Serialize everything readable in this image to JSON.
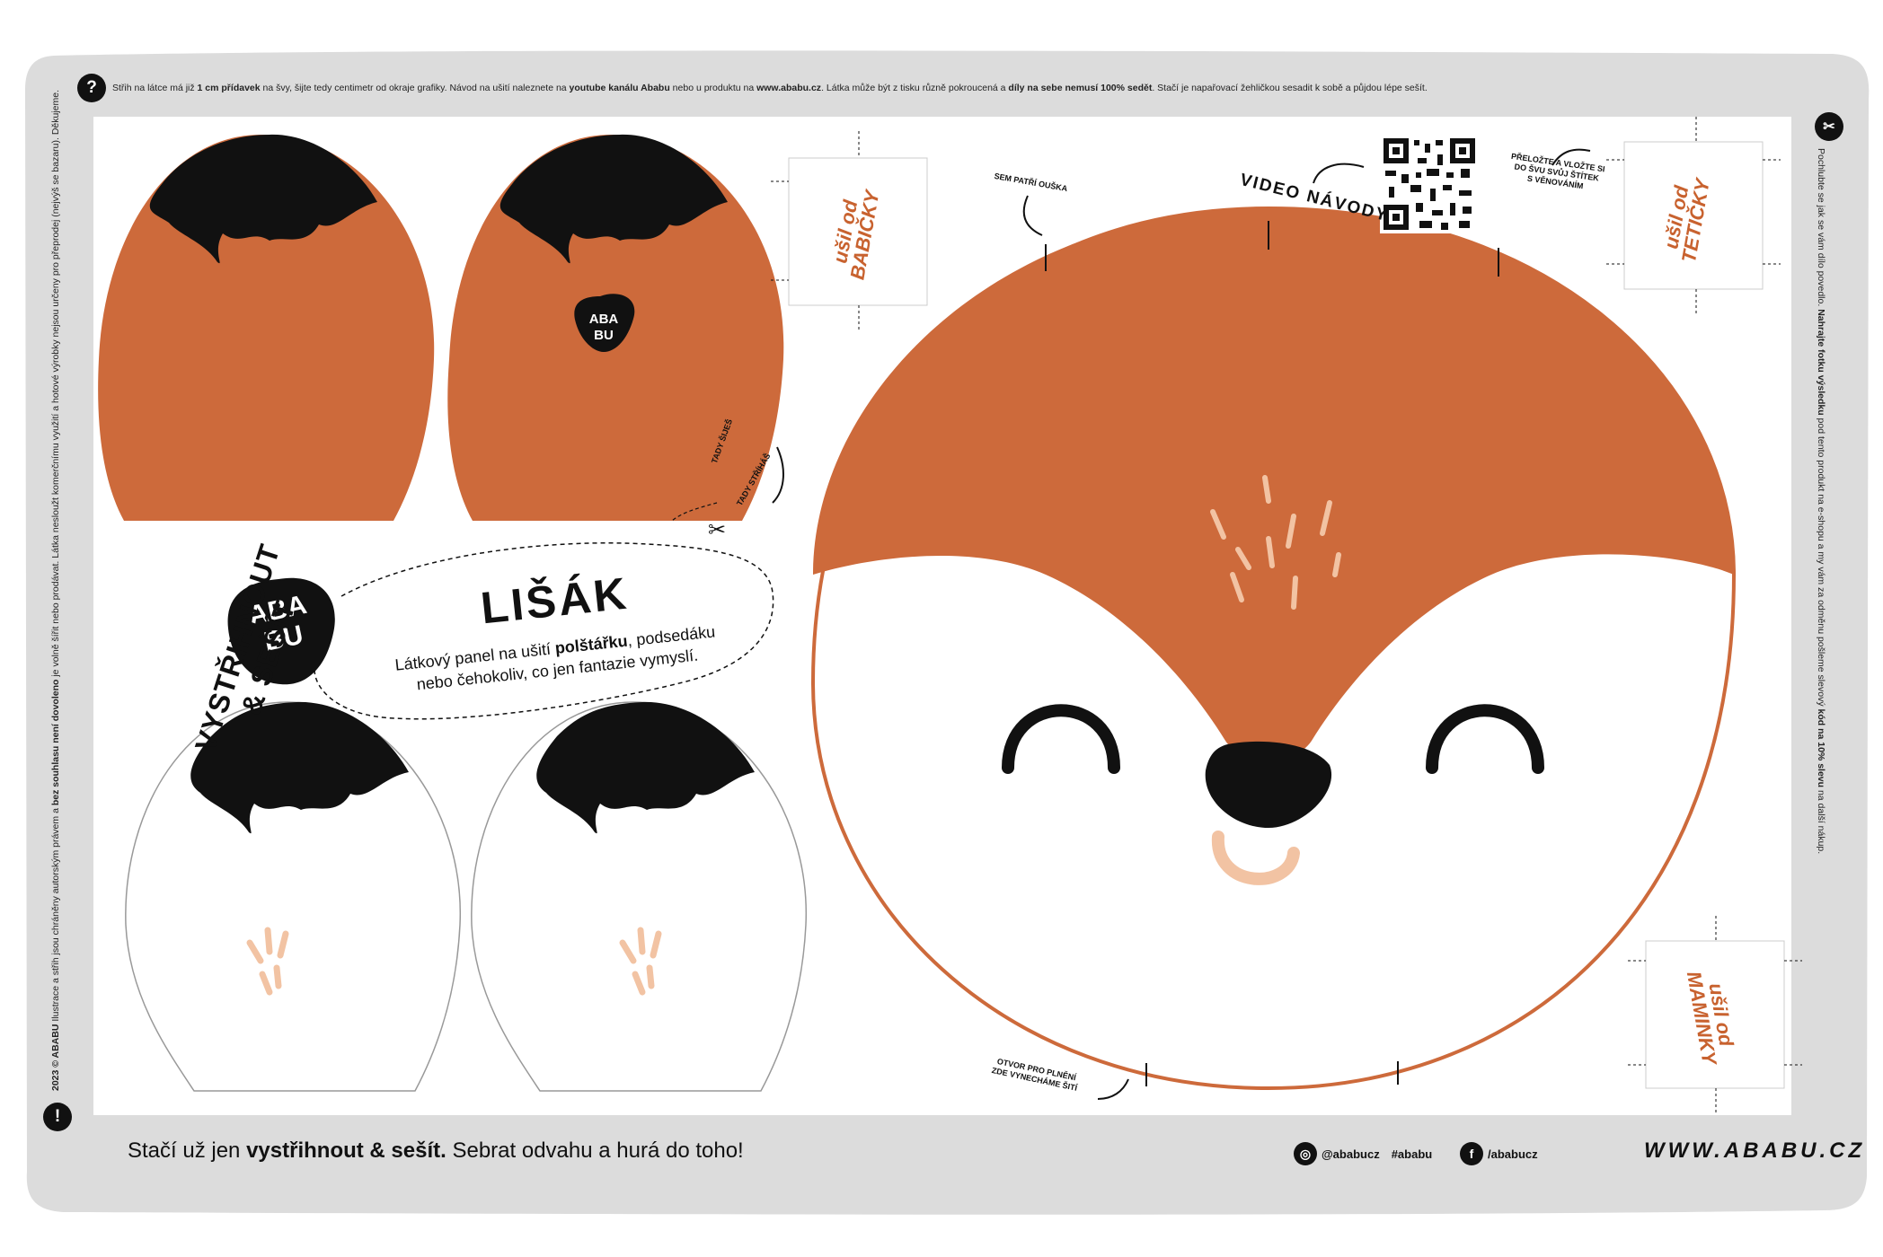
{
  "colors": {
    "fox_orange": "#cd6a3b",
    "black": "#111111",
    "frame_gray": "#dcdcdc",
    "cheek": "#f2c3a3"
  },
  "top_note": {
    "icon": "?",
    "t1": "Střih na látce má již ",
    "b1": "1 cm přídavek",
    "t2": " na švy, šijte tedy centimetr od okraje grafiky. Návod na ušití naleznete na ",
    "b2": "youtube kanálu Ababu",
    "t3": " nebo u produktu na ",
    "b3": "www.ababu.cz",
    "t4": ". Látka může být z tisku různě pokroucená a ",
    "b4": "díly na sebe nemusí 100% sedět",
    "t5": ". Stačí je napařovací žehličkou sesadit k sobě a půjdou lépe sešít."
  },
  "left_note": {
    "icon": "!",
    "b1": "2023 © ABABU",
    "t1": " Ilustrace a střih jsou chráněny autorským právem a ",
    "b2": "bez souhlasu není dovoleno",
    "t2": " je volně šířit nebo prodávat. Látka nesloužt komerčnímu využití a hotové výrobky nejsou určeny pro přeprodej (nejvýš se bazaru). Děkujeme."
  },
  "right_note": {
    "icon": "✂",
    "t1": "Pochlubte se jak se vám dílo povedlo. ",
    "b1": "Nahrajte fotku výsledku",
    "t2": " pod tento produkt na e-shopu a my vám za odměnu pošleme slevový ",
    "b2": "kód na 10% slevu",
    "t3": " na další nákup."
  },
  "logo": {
    "line1": "ABA",
    "line2": "BU"
  },
  "vystrih": "VYSTŘIHNOUT\n& SEŠÍT",
  "title_card": {
    "title": "LIŠÁK",
    "t1": "Látkový panel na ušití ",
    "b1": "polštářku",
    "t2": ", podsedáku",
    "line2": "nebo čehokoliv, co jen fantazie vymyslí."
  },
  "hints": {
    "sem": "SEM PATŘÍ OUŠKA",
    "tady1": "TADY ŠIJEŠ",
    "tady2": "TADY STŘÍHÁŠ",
    "otvor": "OTVOR PRO PLNĚNÍ\nZDE VYNECHÁME ŠITÍ",
    "prelozte": "PŘELOŽTE A VLOŽTE SI\nDO ŠVU SVŮJ ŠTÍTEK\nS VĚNOVÁNÍM"
  },
  "video": "VIDEO NÁVODY",
  "tags": {
    "babicky": "ušil od\nBABIČKY",
    "teticky": "ušil od\nTETIČKY",
    "maminky": "ušil od\nMAMINKY"
  },
  "footer": {
    "t1": "Stačí už jen ",
    "b1": "vystřihnout & sešít.",
    "t2": " Sebrat odvahu a hurá do toho!"
  },
  "instagram": {
    "handle": "@ababucz",
    "tag": "#ababu"
  },
  "facebook": {
    "handle": "/ababucz"
  },
  "website": "WWW.ABABU.CZ"
}
